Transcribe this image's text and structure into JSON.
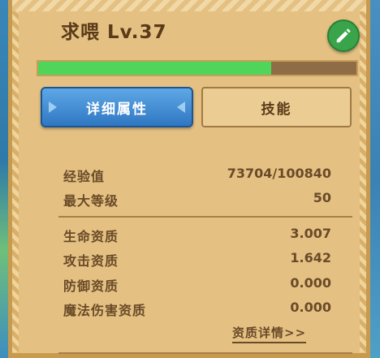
{
  "pet": {
    "name": "求喂",
    "level": "Lv.37"
  },
  "exp_bar": {
    "fraction": 0.731
  },
  "tabs": {
    "details": "详细属性",
    "skills": "技能"
  },
  "stats": {
    "exp_label": "经验值",
    "exp_value": "73704/100840",
    "maxlevel_label": "最大等级",
    "maxlevel_value": "50"
  },
  "aptitudes": [
    {
      "label": "生命资质",
      "value": "3.007"
    },
    {
      "label": "攻击资质",
      "value": "1.642"
    },
    {
      "label": "防御资质",
      "value": "0.000"
    },
    {
      "label": "魔法伤害资质",
      "value": "0.000"
    }
  ],
  "link": {
    "aptitude_detail": "资质详情>>"
  },
  "colors": {
    "exp_fill": "#4fd55a",
    "tab_active": "#2f77c2",
    "edit_button": "#3aa44a"
  },
  "icons": {
    "edit": "pencil-icon"
  }
}
